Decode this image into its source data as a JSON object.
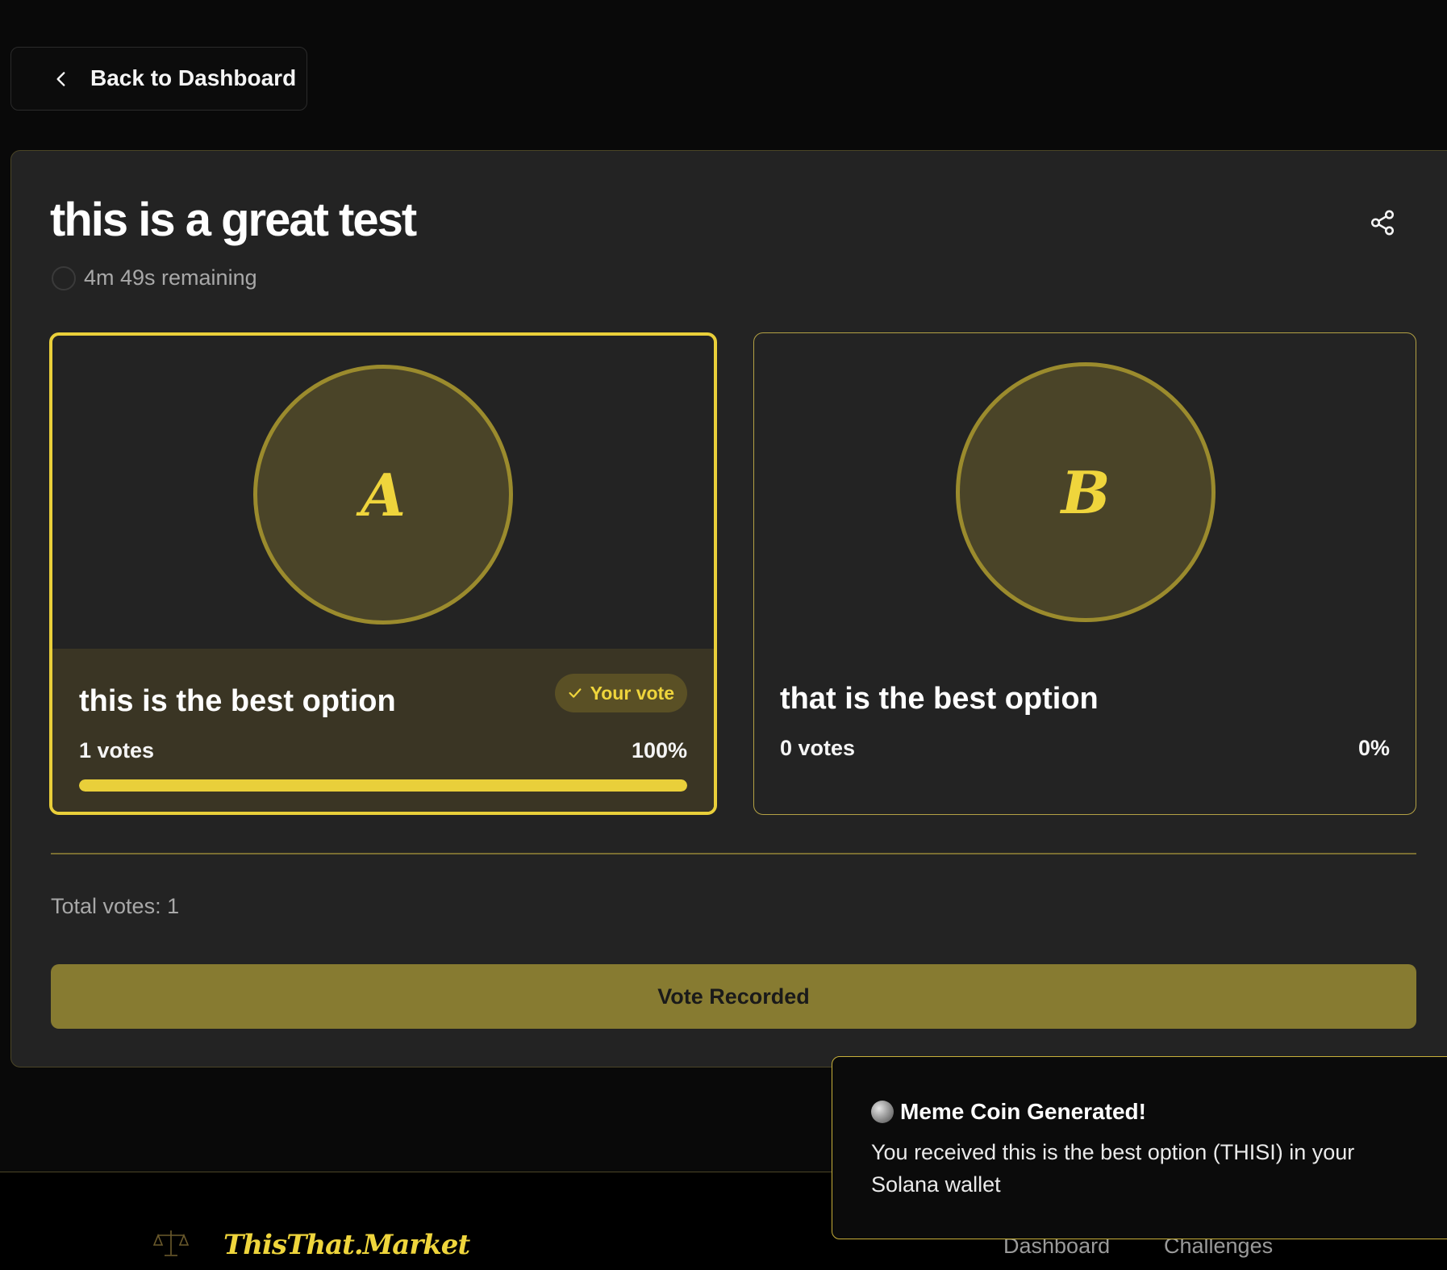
{
  "nav": {
    "back_label": "Back to Dashboard"
  },
  "poll": {
    "title": "this is a great test",
    "time_remaining": "4m 49s remaining",
    "total_votes": "Total votes: 1",
    "vote_button": "Vote Recorded"
  },
  "options": [
    {
      "letter": "A",
      "label": "this is the best option",
      "votes": "1 votes",
      "percent": "100%",
      "fill": 1.0,
      "selected": true,
      "badge": "Your vote"
    },
    {
      "letter": "B",
      "label": "that is the best option",
      "votes": "0 votes",
      "percent": "0%",
      "fill": 0.0,
      "selected": false
    }
  ],
  "toast": {
    "title": "Meme Coin Generated!",
    "message": "You received this is the best option (THISI) in your Solana wallet",
    "icon": "globe-icon"
  },
  "footer": {
    "brand": "ThisThat.Market",
    "logo_icon": "scales-icon",
    "nav": [
      "Dashboard",
      "Challenges"
    ]
  },
  "colors": {
    "accent": "#e9cf3a",
    "background": "#090909",
    "card": "#232323",
    "button": "#877b31"
  }
}
